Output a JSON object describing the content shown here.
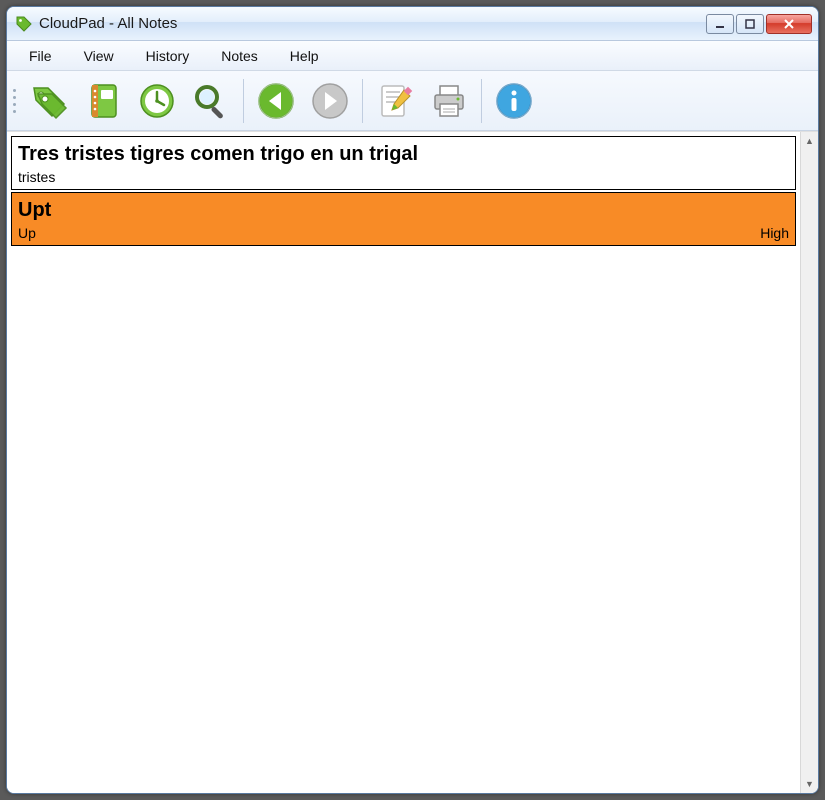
{
  "window": {
    "title": "CloudPad - All Notes"
  },
  "menu": {
    "items": [
      "File",
      "View",
      "History",
      "Notes",
      "Help"
    ]
  },
  "toolbar": {
    "icons": [
      "tag-icon",
      "notebook-icon",
      "history-icon",
      "search-icon",
      "back-icon",
      "forward-icon",
      "edit-icon",
      "print-icon",
      "info-icon"
    ]
  },
  "notes": [
    {
      "title": "Tres tristes tigres comen trigo en un trigal",
      "left": "tristes",
      "right": "",
      "bg": "white"
    },
    {
      "title": "Upt",
      "left": "Up",
      "right": "High",
      "bg": "orange"
    }
  ]
}
